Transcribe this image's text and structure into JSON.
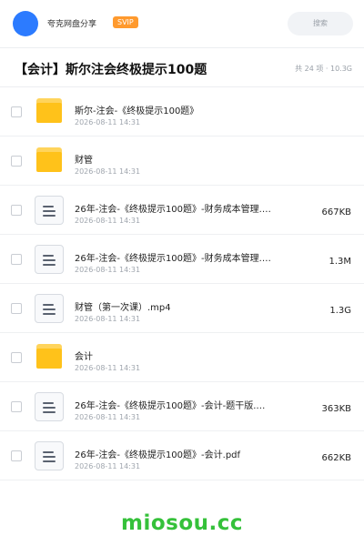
{
  "header": {
    "share_name": "夸克网盘分享",
    "badge": "SVIP",
    "search_placeholder": "搜索"
  },
  "folder": {
    "title": "【会计】斯尔注会终极提示100题",
    "meta": "共 24 项 · 10.3G"
  },
  "files": [
    {
      "name": "斯尔-注会-《终极提示100题》",
      "date": "2026-08-11 14:31",
      "size": "",
      "type": "folder"
    },
    {
      "name": "财管",
      "date": "2026-08-11 14:31",
      "size": "",
      "type": "folder"
    },
    {
      "name": "26年-注会-《终极提示100题》-财务成本管理.…",
      "date": "2026-08-11 14:31",
      "size": "667KB",
      "type": "doc"
    },
    {
      "name": "26年-注会-《终极提示100题》-财务成本管理.…",
      "date": "2026-08-11 14:31",
      "size": "1.3M",
      "type": "doc"
    },
    {
      "name": "财管（第一次课）.mp4",
      "date": "2026-08-11 14:31",
      "size": "1.3G",
      "type": "doc"
    },
    {
      "name": "会计",
      "date": "2026-08-11 14:31",
      "size": "",
      "type": "folder"
    },
    {
      "name": "26年-注会-《终极提示100题》-会计-题干版.…",
      "date": "2026-08-11 14:31",
      "size": "363KB",
      "type": "doc"
    },
    {
      "name": "26年-注会-《终极提示100题》-会计.pdf",
      "date": "2026-08-11 14:31",
      "size": "662KB",
      "type": "doc"
    }
  ],
  "watermark": "miosou.cc"
}
